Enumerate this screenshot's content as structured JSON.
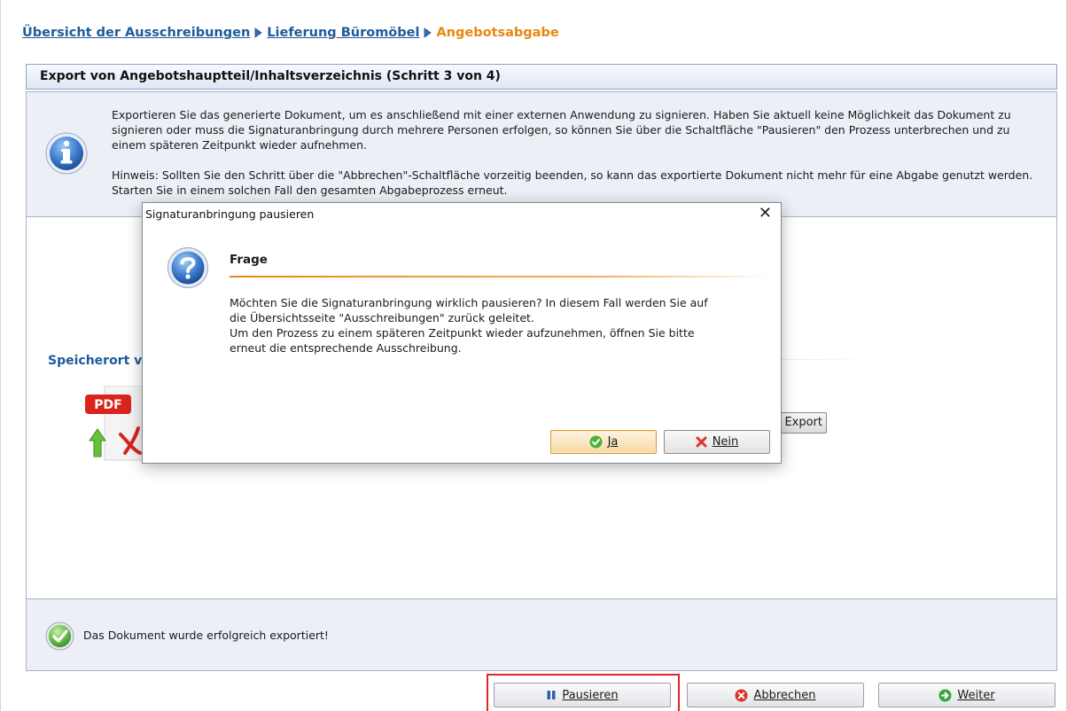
{
  "breadcrumb": {
    "items": [
      "Übersicht der Ausschreibungen",
      "Lieferung Büromöbel"
    ],
    "current": "Angebotsabgabe"
  },
  "step": {
    "title": "Export von Angebotshauptteil/Inhaltsverzeichnis (Schritt 3 von 4)"
  },
  "info": {
    "paragraph1": "Exportieren Sie das generierte Dokument, um es anschließend mit einer externen Anwendung zu signieren. Haben Sie aktuell keine Möglichkeit das Dokument zu signieren oder muss die Signaturanbringung durch mehrere Personen erfolgen, so können Sie über die Schaltfläche \"Pausieren\" den Prozess unterbrechen und zu einem späteren Zeitpunkt wieder aufnehmen.",
    "paragraph2": "Hinweis: Sollten Sie den Schritt über die \"Abbrechen\"-Schaltfläche vorzeitig beenden, so kann das exportierte Dokument nicht mehr für eine Abgabe genutzt werden. Starten Sie in einem solchen Fall den gesamten Abgabeprozess erneut."
  },
  "content": {
    "save_location_label": "Speicherort v",
    "export_button": "Export",
    "pdf_badge": "PDF"
  },
  "status": {
    "text": "Das Dokument wurde erfolgreich exportiert!"
  },
  "buttons": {
    "pause": "Pausieren",
    "cancel": "Abbrechen",
    "next": "Weiter"
  },
  "dialog": {
    "title": "Signaturanbringung pausieren",
    "close": "✕",
    "heading": "Frage",
    "line1": "Möchten Sie die Signaturanbringung wirklich pausieren? In diesem Fall werden Sie auf",
    "line2": "die Übersichtsseite \"Ausschreibungen\" zurück geleitet.",
    "line3": "Um den Prozess zu einem späteren Zeitpunkt wieder aufzunehmen, öffnen Sie bitte",
    "line4": "erneut die entsprechende Ausschreibung.",
    "yes": "Ja",
    "no": "Nein"
  },
  "colors": {
    "link": "#1f5b99",
    "accent_orange": "#e8870f",
    "panel_bg": "#eceff6",
    "highlight": "#e0242a"
  },
  "icons": [
    "breadcrumb-arrow-icon",
    "info-icon",
    "pdf-icon",
    "success-check-icon",
    "pause-icon",
    "cancel-icon",
    "next-arrow-icon",
    "question-icon",
    "ok-check-icon",
    "no-cross-icon"
  ]
}
